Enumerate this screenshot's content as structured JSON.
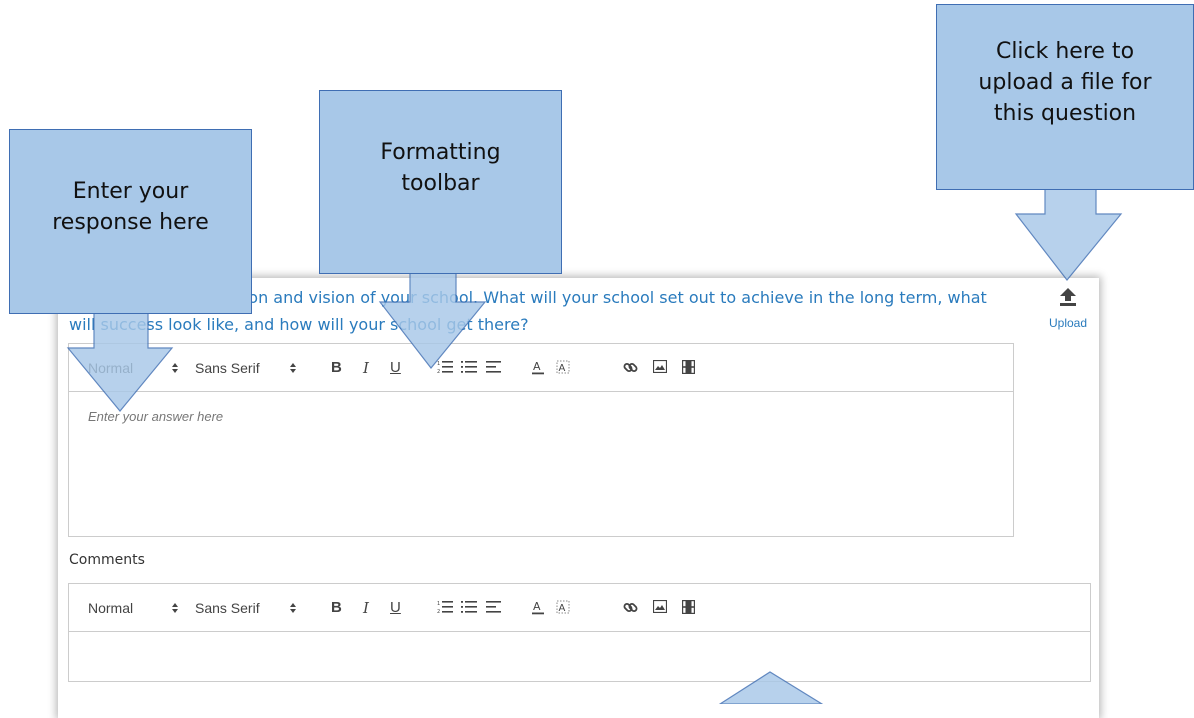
{
  "question": {
    "text": "Q11. Explain the mission and vision of your school. What will your school set out to achieve in the long term, what will success look like, and how will your school get there?"
  },
  "upload": {
    "label": "Upload",
    "icon": "upload-icon"
  },
  "answer_editor": {
    "toolbar": {
      "header_picker": "Normal",
      "font_picker": "Sans Serif",
      "bold": "B",
      "italic": "I",
      "underline": "U"
    },
    "placeholder": "Enter your answer here"
  },
  "comments": {
    "label": "Comments",
    "toolbar": {
      "header_picker": "Normal",
      "font_picker": "Sans Serif",
      "bold": "B",
      "italic": "I",
      "underline": "U"
    }
  },
  "callouts": {
    "response": "Enter your response here",
    "toolbar": "Formatting toolbar",
    "upload": "Click here to upload a file for this question"
  },
  "colors": {
    "link_blue": "#2a7bbd",
    "callout_fill": "#a8c8e8",
    "callout_border": "#3f6eb3"
  }
}
